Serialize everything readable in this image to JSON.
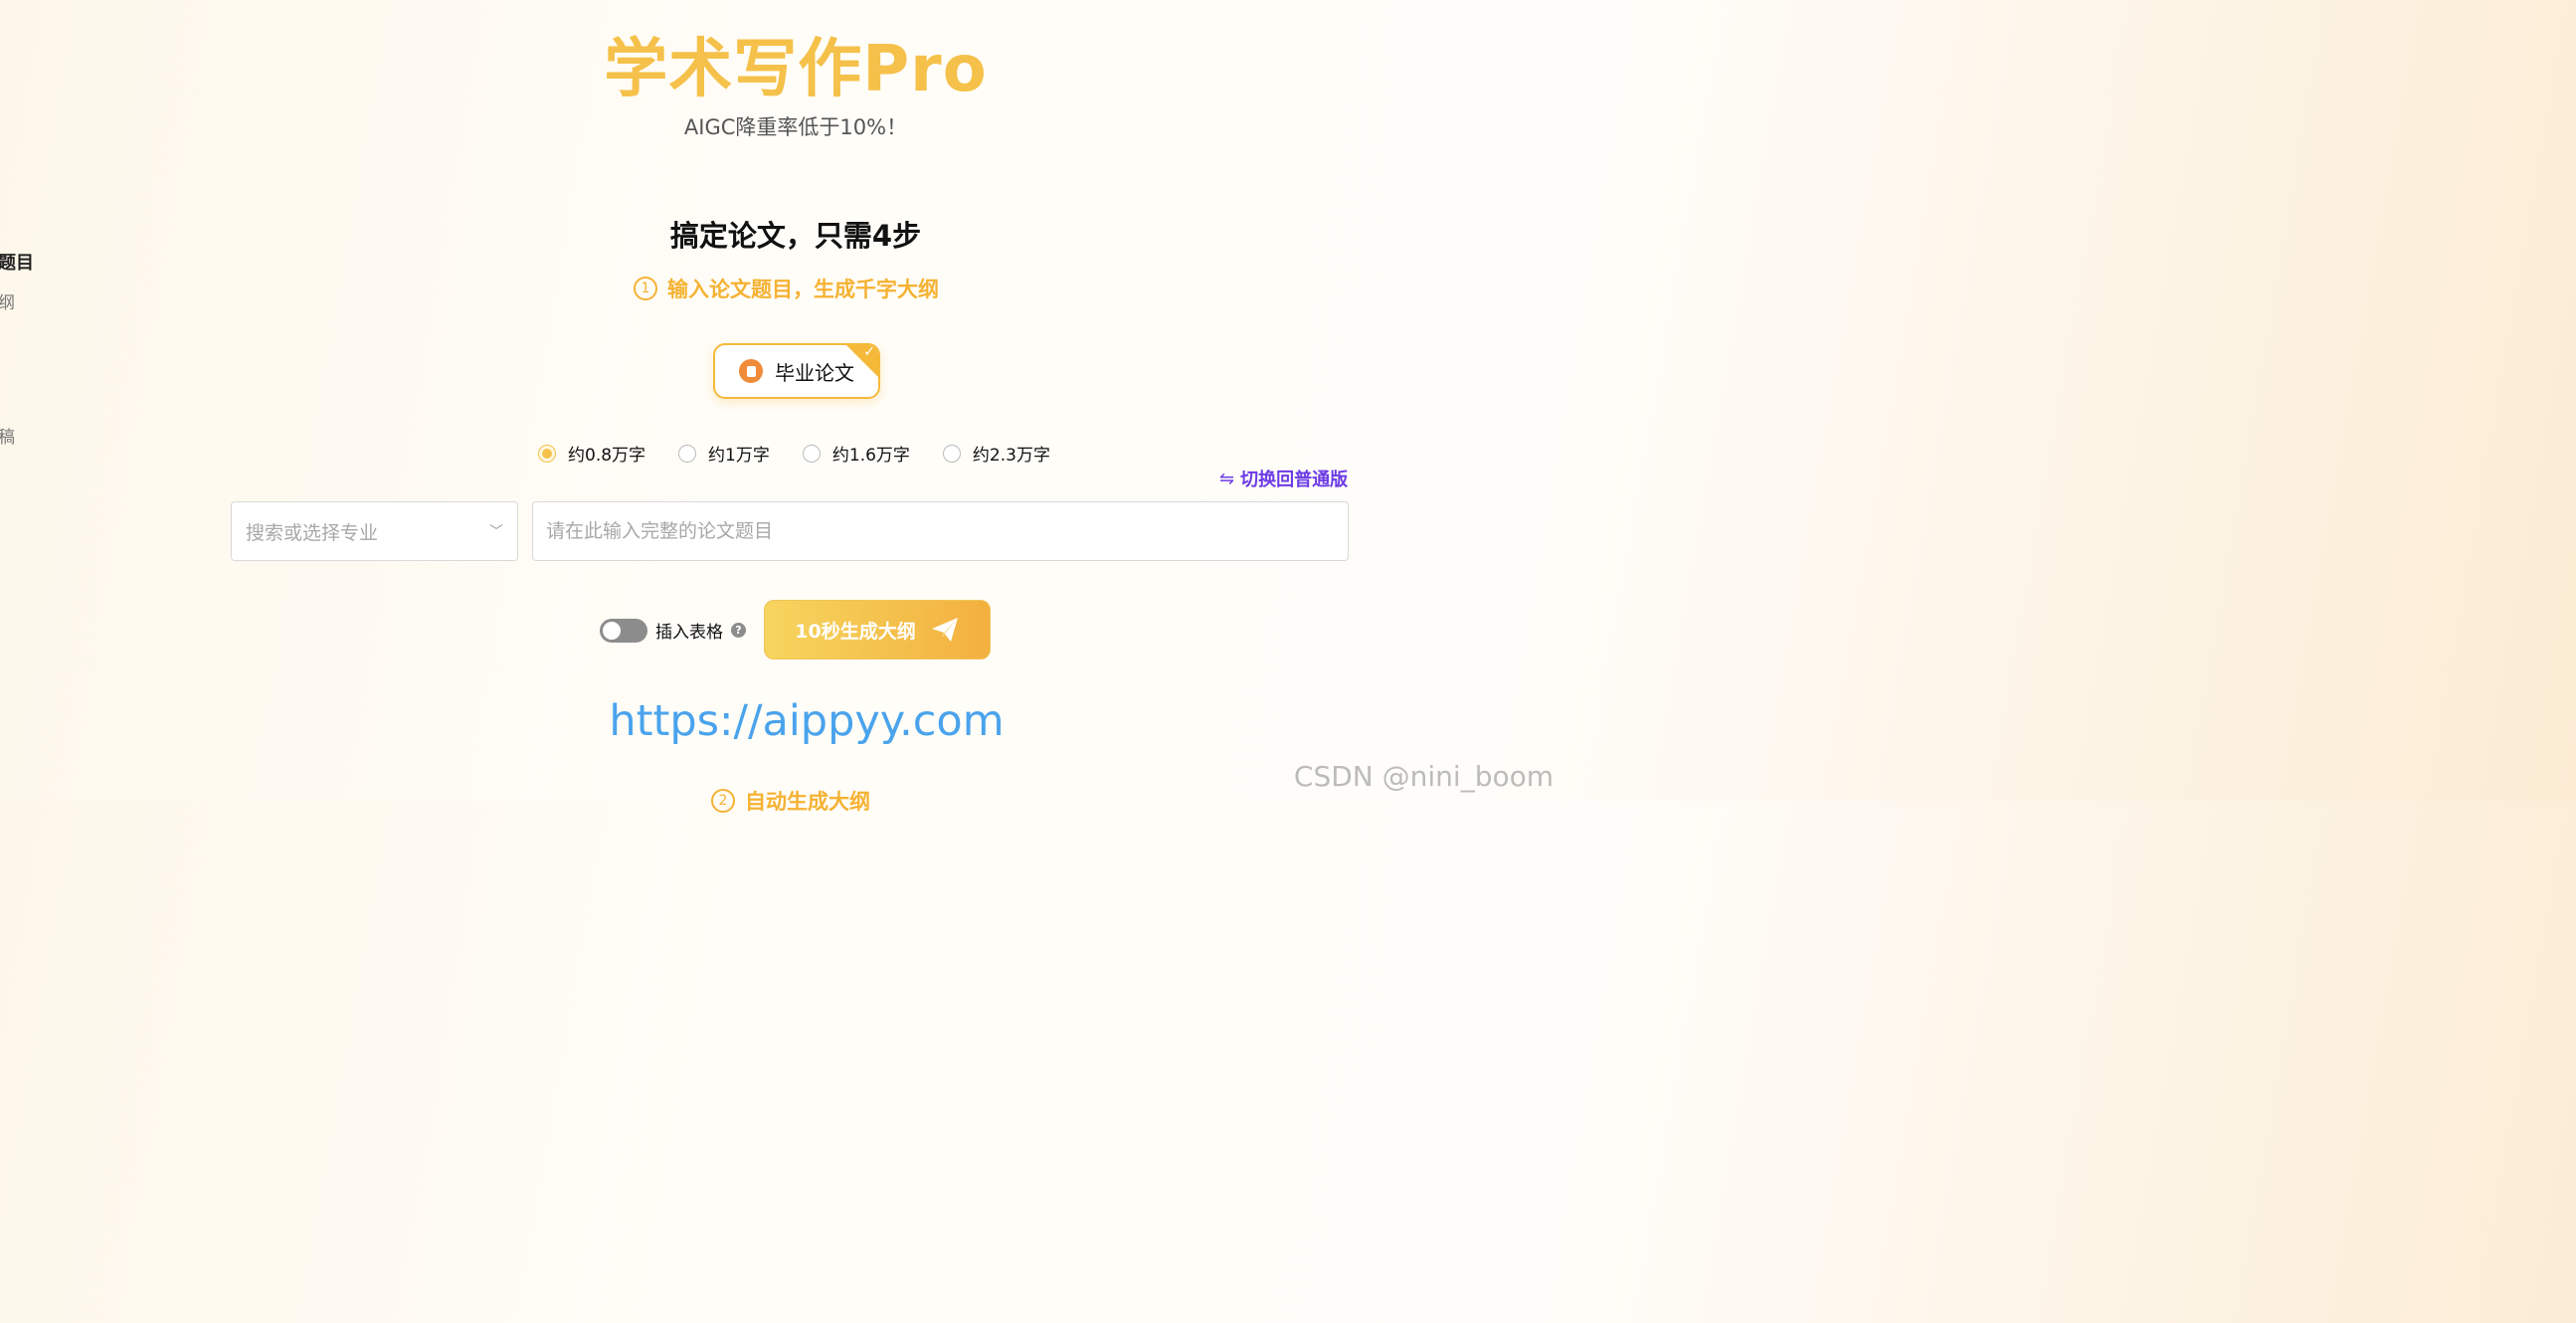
{
  "hero": {
    "title": "学术写作Pro",
    "subtitle": "AIGC降重率低于10%！"
  },
  "left_panel": {
    "item_title": "题目",
    "item_a": "纲",
    "item_b": "稿"
  },
  "steps": {
    "title": "搞定论文，只需4步",
    "step1_number": "1",
    "step1_text": "输入论文题目，生成千字大纲",
    "step2_number": "2",
    "step2_text": "自动生成大纲"
  },
  "paper_type": {
    "label": "毕业论文",
    "selected": true
  },
  "word_counts": [
    {
      "label": "约0.8万字",
      "selected": true
    },
    {
      "label": "约1万字",
      "selected": false
    },
    {
      "label": "约1.6万字",
      "selected": false
    },
    {
      "label": "约2.3万字",
      "selected": false
    }
  ],
  "switch_version": {
    "label": "切换回普通版"
  },
  "major_select": {
    "placeholder": "搜索或选择专业"
  },
  "title_input": {
    "value": "",
    "placeholder": "请在此输入完整的论文题目"
  },
  "insert_table": {
    "label": "插入表格",
    "enabled": false,
    "help": "?"
  },
  "generate_button": {
    "label": "10秒生成大纲"
  },
  "url": "https://aippyy.com",
  "watermark": "CSDN @nini_boom",
  "colors": {
    "accent": "#f5c14a",
    "link": "#6c3be6",
    "url": "#4aa3ec",
    "icon_orange": "#f08b3a"
  }
}
